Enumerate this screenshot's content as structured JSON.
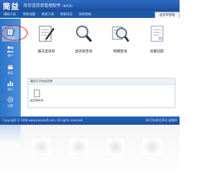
{
  "app": {
    "logo": "简益",
    "title": "库存送货单管理软件",
    "version": "(单机版)"
  },
  "menu": [
    {
      "label": "辅助工具"
    },
    {
      "label": "系统设置"
    },
    {
      "label": "系统工具"
    },
    {
      "label": "系统日志"
    },
    {
      "label": "系统帮助"
    }
  ],
  "active_tab": "送货单管理",
  "sidebar": [
    {
      "label": "送货单",
      "icon": "form-icon"
    },
    {
      "label": "客户",
      "icon": "people-icon"
    },
    {
      "label": "商品",
      "icon": "box-icon"
    },
    {
      "label": "统计",
      "icon": "chart-icon"
    },
    {
      "label": "设置",
      "icon": "gear-icon"
    }
  ],
  "actions": [
    {
      "label": "填写送货单",
      "icon": "pen-form-icon"
    },
    {
      "label": "送货单查询",
      "icon": "magnifier-icon"
    },
    {
      "label": "明细查询",
      "icon": "magnifier-form-icon"
    },
    {
      "label": "流量回顾",
      "icon": "document-icon"
    }
  ],
  "recent_panel": {
    "title": "最近打开的送货单",
    "item_label": "送货单样本"
  },
  "status": {
    "copyright": "Copyright © 2006 www.jianyisoft.com. All rights reserved.",
    "datetime": "2017年06月29日 星期四"
  },
  "colors": {
    "accent": "#1c58a8",
    "sidebar": "#3a80d2",
    "highlight": "#e02020"
  }
}
